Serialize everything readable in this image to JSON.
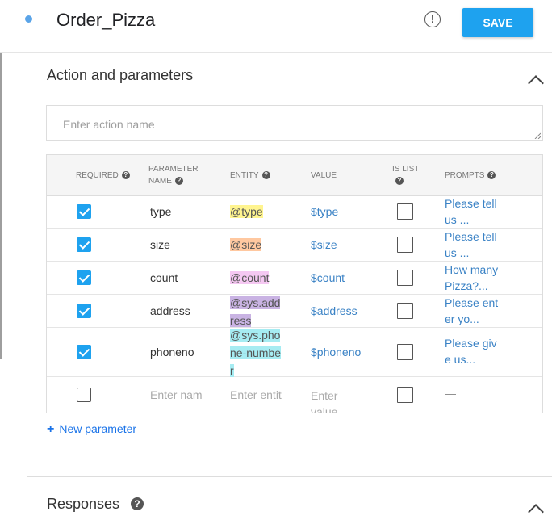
{
  "header": {
    "title": "Order_Pizza",
    "save_label": "SAVE"
  },
  "section": {
    "title": "Action and parameters",
    "action_placeholder": "Enter action name"
  },
  "table": {
    "headers": {
      "required": "REQUIRED",
      "param_name_1": "PARAMETER",
      "param_name_2": "NAME",
      "entity": "ENTITY",
      "value": "VALUE",
      "is_list_1": "IS LIST",
      "prompts": "PROMPTS"
    },
    "rows": [
      {
        "required": true,
        "name": "type",
        "entity": "@type",
        "entity_color": "#fff48f",
        "value": "$type",
        "is_list": false,
        "prompt": "Please tell us ..."
      },
      {
        "required": true,
        "name": "size",
        "entity": "@size",
        "entity_color": "#ffc8a0",
        "value": "$size",
        "is_list": false,
        "prompt": "Please tell us ..."
      },
      {
        "required": true,
        "name": "count",
        "entity": "@count",
        "entity_color": "#f5c8f2",
        "value": "$count",
        "is_list": false,
        "prompt": "How many Pizza?..."
      },
      {
        "required": true,
        "name": "address",
        "entity": "@sys.address",
        "entity_color": "#c9b3e3",
        "value": "$address",
        "is_list": false,
        "prompt": "Please enter yo..."
      },
      {
        "required": true,
        "name": "phoneno",
        "entity": "@sys.phone-number",
        "entity_color": "#a6ecf2",
        "value": "$phoneno",
        "is_list": false,
        "prompt": "Please give us..."
      }
    ],
    "empty_row": {
      "name_placeholder": "Enter nam",
      "entity_placeholder": "Enter entit",
      "value_placeholder": "Enter value",
      "prompt": "—"
    }
  },
  "new_param_label": "New parameter",
  "responses_title": "Responses"
}
